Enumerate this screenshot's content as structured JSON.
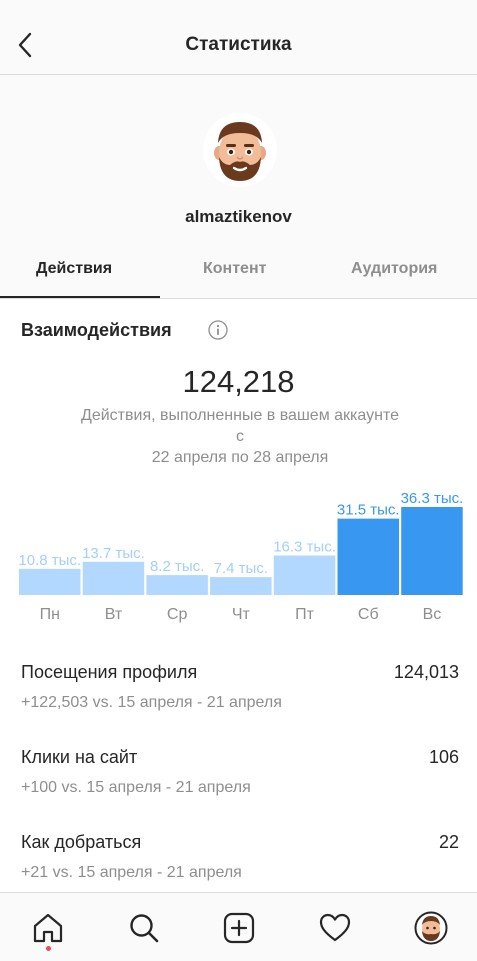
{
  "header": {
    "title": "Статистика"
  },
  "profile": {
    "username": "almaztikenov"
  },
  "tabs": [
    {
      "label": "Действия"
    },
    {
      "label": "Контент"
    },
    {
      "label": "Аудитория"
    }
  ],
  "interactions": {
    "title": "Взаимодействия",
    "total": "124,218",
    "description": "Действия, выполненные в вашем аккаунте с",
    "date_range": "22 апреля по 28 апреля"
  },
  "chart_data": {
    "type": "bar",
    "categories": [
      "Пн",
      "Вт",
      "Ср",
      "Чт",
      "Пт",
      "Сб",
      "Вс"
    ],
    "values": [
      10.8,
      13.7,
      8.2,
      7.4,
      16.3,
      31.5,
      36.3
    ],
    "value_labels": [
      "10.8 тыс.",
      "13.7 тыс.",
      "8.2 тыс.",
      "7.4 тыс.",
      "16.3 тыс.",
      "31.5 тыс.",
      "36.3 тыс."
    ],
    "unit": "тыс.",
    "highlighted": [
      false,
      false,
      false,
      false,
      false,
      true,
      true
    ],
    "colors": {
      "normal": "#b3d8ff",
      "highlight": "#3897f0",
      "label_normal": "#a3ceff",
      "label_highlight": "#3897f0",
      "tick": "#8e8e8e"
    }
  },
  "stats": [
    {
      "label": "Посещения профиля",
      "value": "124,013",
      "comparison": "+122,503 vs. 15 апреля - 21 апреля"
    },
    {
      "label": "Клики на сайт",
      "value": "106",
      "comparison": "+100 vs. 15 апреля - 21 апреля"
    },
    {
      "label": "Как добраться",
      "value": "22",
      "comparison": "+21 vs. 15 апреля - 21 апреля"
    }
  ],
  "nav": {
    "items": [
      "home-icon",
      "search-icon",
      "add-post-icon",
      "activity-heart-icon",
      "profile-avatar-icon"
    ]
  }
}
